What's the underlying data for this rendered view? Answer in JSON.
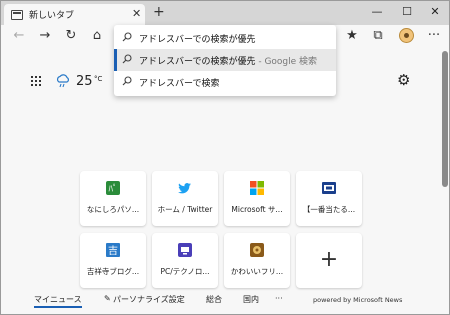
{
  "tab": {
    "title": "新しいタブ",
    "close": "✕"
  },
  "new_tab": "+",
  "window_controls": {
    "minimize": "—",
    "maximize": "☐",
    "close": "✕"
  },
  "omnibox": {
    "suggestions": [
      {
        "text": "アドレスバーでの検索が優先",
        "sub": ""
      },
      {
        "text": "アドレスバーでの検索が優先",
        "sub": " - Google 検索"
      },
      {
        "text": "アドレスバーで検索",
        "sub": ""
      }
    ]
  },
  "weather": {
    "temperature": "25",
    "unit": "°C"
  },
  "tiles": [
    {
      "label": "なにしろパソ...",
      "logo": "nanishiro-logo",
      "color": "#2a8c3a"
    },
    {
      "label": "ホーム / Twitter",
      "logo": "twitter-logo",
      "color": "#1da1f2"
    },
    {
      "label": "Microsoft サ...",
      "logo": "microsoft-logo",
      "color": "#f25022"
    },
    {
      "label": "【一番当たる...",
      "logo": "ichiban-logo",
      "color": "#1a3f8c"
    },
    {
      "label": "吉祥寺ブログ...",
      "logo": "kichijoji-logo",
      "color": "#2a7ac8"
    },
    {
      "label": "PC/テクノロ...",
      "logo": "pc-techno-logo",
      "color": "#4a3fb8"
    },
    {
      "label": "かわいいフリ...",
      "logo": "kawaii-logo",
      "color": "#8a5a1a"
    },
    {
      "label": "",
      "logo": "plus-icon",
      "color": "#333333"
    }
  ],
  "add_tile": "+",
  "bottom_nav": {
    "items": [
      {
        "label": "マイニュース"
      },
      {
        "label": "パーソナライズ設定"
      },
      {
        "label": "総合"
      },
      {
        "label": "国内"
      },
      {
        "label": "···"
      }
    ],
    "powered_by": "powered by Microsoft News"
  },
  "colors": {
    "accent": "#1a5fb4",
    "background": "#f7f7f7",
    "titlebar": "#d6d6d6"
  }
}
